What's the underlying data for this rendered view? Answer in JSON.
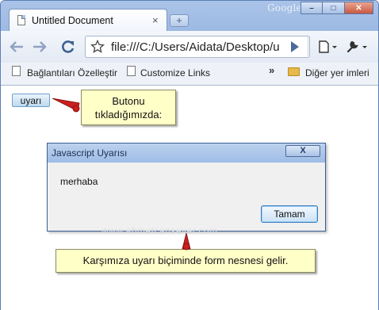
{
  "window": {
    "brand": "Google",
    "controls": {
      "minimize": "–",
      "maximize": "□",
      "close": "✕"
    }
  },
  "tabs": [
    {
      "title": "Untitled Document",
      "close": "×"
    }
  ],
  "newtab": "+",
  "toolbar": {
    "url": "file:///C:/Users/Aidata/Desktop/u"
  },
  "bookmarks": {
    "items": [
      {
        "label": "Bağlantıları Özelleştir"
      },
      {
        "label": "Customize Links"
      }
    ],
    "overflow": "»",
    "other": "Diğer yer imleri"
  },
  "page": {
    "button_label": "uyarı"
  },
  "notes": {
    "top": [
      "Butonu",
      "tıkladığımızda:"
    ],
    "bottom": "Karşımıza uyarı biçiminde form nesnesi gelir."
  },
  "dialog": {
    "title": "Javascript Uyarısı",
    "close": "X",
    "message": "merhaba",
    "ok_label": "Tamam"
  },
  "watermark": "www.ahmetcansever.com",
  "colors": {
    "accent_red": "#cc1f1f",
    "note_bg": "#ffffc8",
    "chrome_blue": "#9dbae3"
  }
}
